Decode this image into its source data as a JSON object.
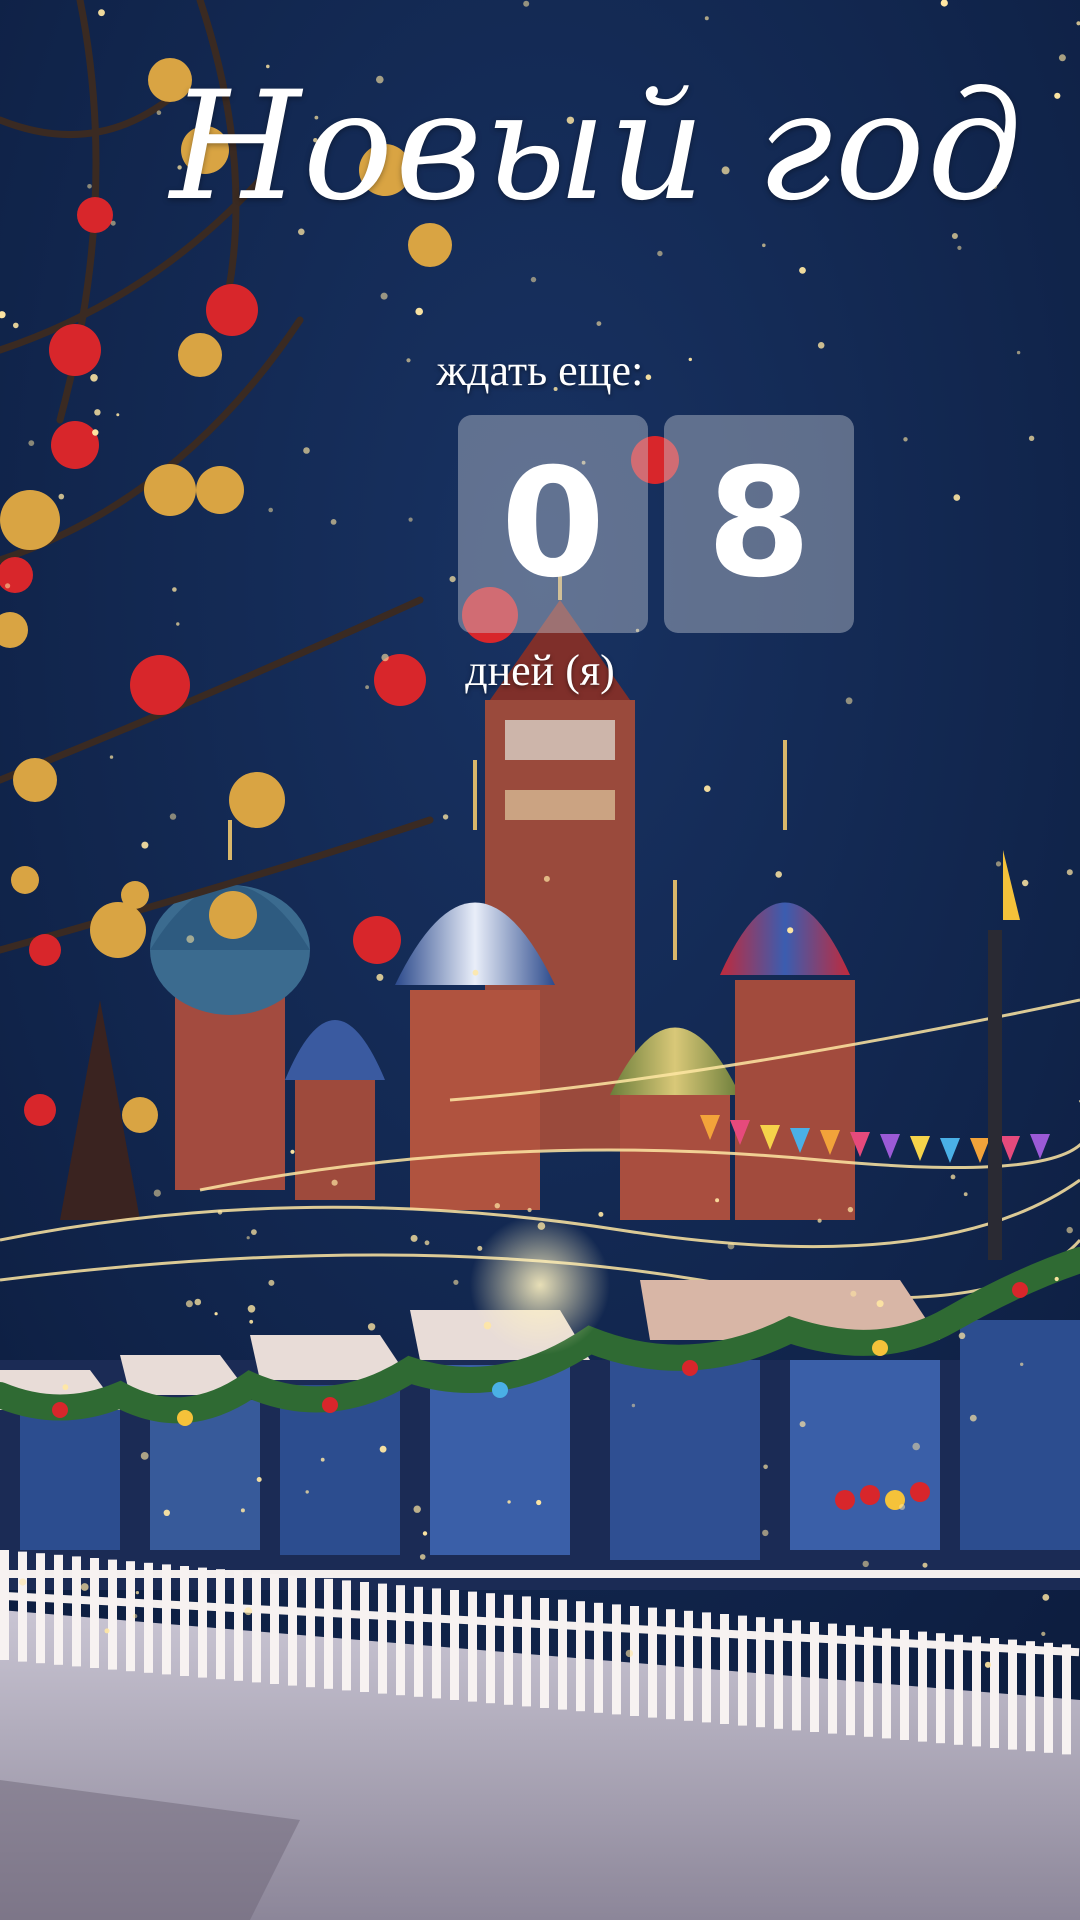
{
  "header": {
    "title": "Новый год"
  },
  "countdown": {
    "label": "ждать еще:",
    "digits": [
      "0",
      "8"
    ],
    "units": "дней (я)"
  },
  "colors": {
    "sky": "#10234a",
    "text": "#ffffff",
    "ornament_red": "#d8262b",
    "ornament_gold": "#d9a443",
    "string_light": "#ffe7a3",
    "snow": "#e8e9ef"
  }
}
